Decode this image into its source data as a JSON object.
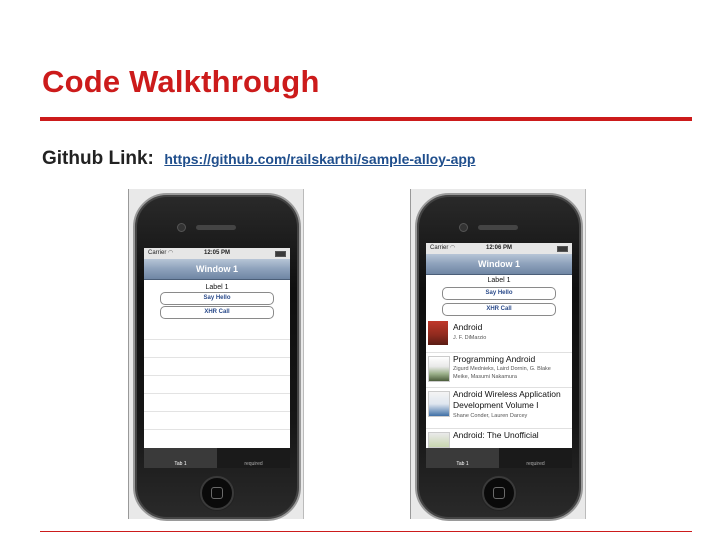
{
  "slide": {
    "title": "Code Walkthrough",
    "github_label": "Github Link:",
    "github_url": "https://github.com/railskarthi/sample-alloy-app"
  },
  "left_phone": {
    "status": {
      "carrier": "Carrier",
      "time": "12:05 PM"
    },
    "nav_title": "Window 1",
    "label": "Label 1",
    "buttons": [
      "Say Hello",
      "XHR Call"
    ],
    "tabs": [
      "Tab 1",
      "required"
    ]
  },
  "right_phone": {
    "status": {
      "carrier": "Carrier",
      "time": "12:06 PM"
    },
    "nav_title": "Window 1",
    "label": "Label 1",
    "buttons": [
      "Say Hello",
      "XHR Call"
    ],
    "tabs": [
      "Tab 1",
      "required"
    ],
    "books": [
      {
        "title": "Android",
        "authors": [
          "J. F. DiMarzio"
        ]
      },
      {
        "title": "Programming Android",
        "authors": [
          "Zigurd Mednieks, Laird Dornin, G. Blake",
          "Meike, Masumi Nakamura"
        ]
      },
      {
        "title": "Android Wireless Application",
        "title2": "Development Volume I",
        "authors": [
          "Shane Conder, Lauren Darcey"
        ]
      },
      {
        "title": "Android: The Unofficial",
        "authors": []
      }
    ]
  },
  "colors": {
    "accent": "#cc1b1b",
    "link": "#1f4e8c",
    "navbar": "#8da1bb"
  }
}
